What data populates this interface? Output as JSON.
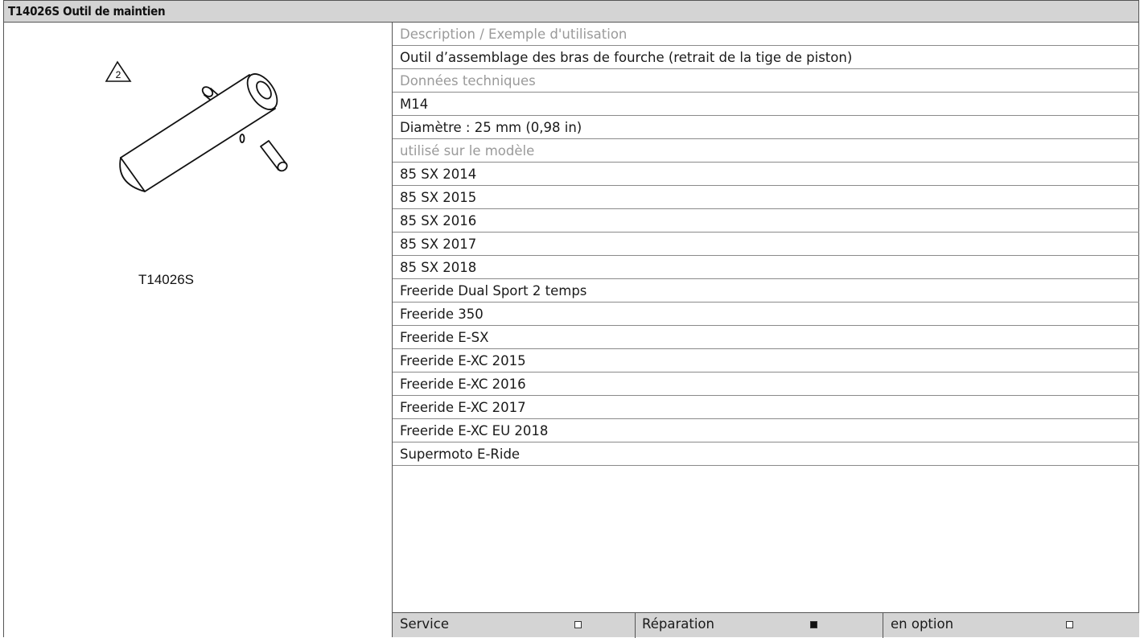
{
  "title": "T14026S Outil de maintien",
  "image": {
    "warning_number": "2",
    "tool_code": "T14026S"
  },
  "rows": [
    {
      "text": "Description / Exemple d'utilisation",
      "kind": "label"
    },
    {
      "text": "Outil d’assemblage des bras de fourche (retrait de la tige de piston)",
      "kind": "value"
    },
    {
      "text": "Données techniques",
      "kind": "label"
    },
    {
      "text": "M14",
      "kind": "value"
    },
    {
      "text": "Diamètre : 25 mm (0,98 in)",
      "kind": "value"
    },
    {
      "text": "utilisé sur le modèle",
      "kind": "label"
    },
    {
      "text": "85 SX 2014",
      "kind": "value"
    },
    {
      "text": "85 SX 2015",
      "kind": "value"
    },
    {
      "text": "85 SX 2016",
      "kind": "value"
    },
    {
      "text": "85 SX 2017",
      "kind": "value"
    },
    {
      "text": "85 SX 2018",
      "kind": "value"
    },
    {
      "text": "Freeride Dual Sport 2 temps",
      "kind": "value"
    },
    {
      "text": "Freeride 350",
      "kind": "value"
    },
    {
      "text": "Freeride E-SX",
      "kind": "value"
    },
    {
      "text": "Freeride E-XC 2015",
      "kind": "value"
    },
    {
      "text": "Freeride E-XC 2016",
      "kind": "value"
    },
    {
      "text": "Freeride E-XC 2017",
      "kind": "value"
    },
    {
      "text": "Freeride E-XC EU 2018",
      "kind": "value"
    },
    {
      "text": "Supermoto E-Ride",
      "kind": "value"
    }
  ],
  "categories": [
    {
      "label": "Service",
      "checked": false
    },
    {
      "label": "Réparation",
      "checked": true
    },
    {
      "label": "en option",
      "checked": false
    }
  ]
}
